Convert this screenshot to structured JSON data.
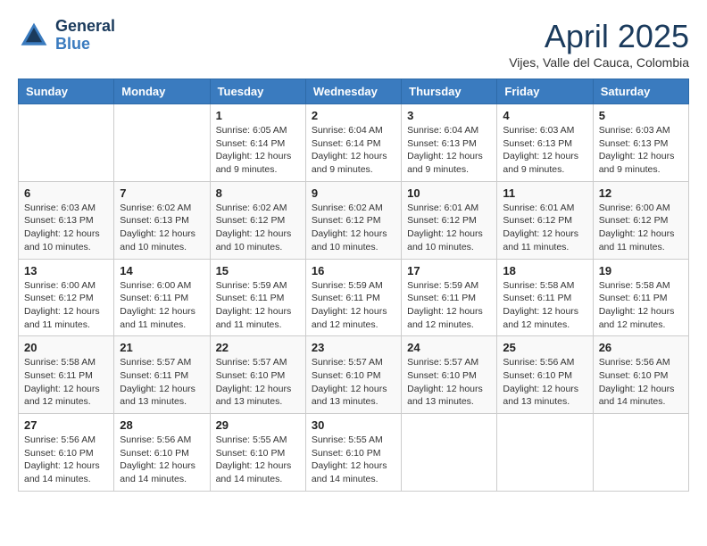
{
  "logo": {
    "general": "General",
    "blue": "Blue"
  },
  "title": "April 2025",
  "location": "Vijes, Valle del Cauca, Colombia",
  "weekdays": [
    "Sunday",
    "Monday",
    "Tuesday",
    "Wednesday",
    "Thursday",
    "Friday",
    "Saturday"
  ],
  "weeks": [
    [
      {
        "day": "",
        "info": ""
      },
      {
        "day": "",
        "info": ""
      },
      {
        "day": "1",
        "info": "Sunrise: 6:05 AM\nSunset: 6:14 PM\nDaylight: 12 hours and 9 minutes."
      },
      {
        "day": "2",
        "info": "Sunrise: 6:04 AM\nSunset: 6:14 PM\nDaylight: 12 hours and 9 minutes."
      },
      {
        "day": "3",
        "info": "Sunrise: 6:04 AM\nSunset: 6:13 PM\nDaylight: 12 hours and 9 minutes."
      },
      {
        "day": "4",
        "info": "Sunrise: 6:03 AM\nSunset: 6:13 PM\nDaylight: 12 hours and 9 minutes."
      },
      {
        "day": "5",
        "info": "Sunrise: 6:03 AM\nSunset: 6:13 PM\nDaylight: 12 hours and 9 minutes."
      }
    ],
    [
      {
        "day": "6",
        "info": "Sunrise: 6:03 AM\nSunset: 6:13 PM\nDaylight: 12 hours and 10 minutes."
      },
      {
        "day": "7",
        "info": "Sunrise: 6:02 AM\nSunset: 6:13 PM\nDaylight: 12 hours and 10 minutes."
      },
      {
        "day": "8",
        "info": "Sunrise: 6:02 AM\nSunset: 6:12 PM\nDaylight: 12 hours and 10 minutes."
      },
      {
        "day": "9",
        "info": "Sunrise: 6:02 AM\nSunset: 6:12 PM\nDaylight: 12 hours and 10 minutes."
      },
      {
        "day": "10",
        "info": "Sunrise: 6:01 AM\nSunset: 6:12 PM\nDaylight: 12 hours and 10 minutes."
      },
      {
        "day": "11",
        "info": "Sunrise: 6:01 AM\nSunset: 6:12 PM\nDaylight: 12 hours and 11 minutes."
      },
      {
        "day": "12",
        "info": "Sunrise: 6:00 AM\nSunset: 6:12 PM\nDaylight: 12 hours and 11 minutes."
      }
    ],
    [
      {
        "day": "13",
        "info": "Sunrise: 6:00 AM\nSunset: 6:12 PM\nDaylight: 12 hours and 11 minutes."
      },
      {
        "day": "14",
        "info": "Sunrise: 6:00 AM\nSunset: 6:11 PM\nDaylight: 12 hours and 11 minutes."
      },
      {
        "day": "15",
        "info": "Sunrise: 5:59 AM\nSunset: 6:11 PM\nDaylight: 12 hours and 11 minutes."
      },
      {
        "day": "16",
        "info": "Sunrise: 5:59 AM\nSunset: 6:11 PM\nDaylight: 12 hours and 12 minutes."
      },
      {
        "day": "17",
        "info": "Sunrise: 5:59 AM\nSunset: 6:11 PM\nDaylight: 12 hours and 12 minutes."
      },
      {
        "day": "18",
        "info": "Sunrise: 5:58 AM\nSunset: 6:11 PM\nDaylight: 12 hours and 12 minutes."
      },
      {
        "day": "19",
        "info": "Sunrise: 5:58 AM\nSunset: 6:11 PM\nDaylight: 12 hours and 12 minutes."
      }
    ],
    [
      {
        "day": "20",
        "info": "Sunrise: 5:58 AM\nSunset: 6:11 PM\nDaylight: 12 hours and 12 minutes."
      },
      {
        "day": "21",
        "info": "Sunrise: 5:57 AM\nSunset: 6:11 PM\nDaylight: 12 hours and 13 minutes."
      },
      {
        "day": "22",
        "info": "Sunrise: 5:57 AM\nSunset: 6:10 PM\nDaylight: 12 hours and 13 minutes."
      },
      {
        "day": "23",
        "info": "Sunrise: 5:57 AM\nSunset: 6:10 PM\nDaylight: 12 hours and 13 minutes."
      },
      {
        "day": "24",
        "info": "Sunrise: 5:57 AM\nSunset: 6:10 PM\nDaylight: 12 hours and 13 minutes."
      },
      {
        "day": "25",
        "info": "Sunrise: 5:56 AM\nSunset: 6:10 PM\nDaylight: 12 hours and 13 minutes."
      },
      {
        "day": "26",
        "info": "Sunrise: 5:56 AM\nSunset: 6:10 PM\nDaylight: 12 hours and 14 minutes."
      }
    ],
    [
      {
        "day": "27",
        "info": "Sunrise: 5:56 AM\nSunset: 6:10 PM\nDaylight: 12 hours and 14 minutes."
      },
      {
        "day": "28",
        "info": "Sunrise: 5:56 AM\nSunset: 6:10 PM\nDaylight: 12 hours and 14 minutes."
      },
      {
        "day": "29",
        "info": "Sunrise: 5:55 AM\nSunset: 6:10 PM\nDaylight: 12 hours and 14 minutes."
      },
      {
        "day": "30",
        "info": "Sunrise: 5:55 AM\nSunset: 6:10 PM\nDaylight: 12 hours and 14 minutes."
      },
      {
        "day": "",
        "info": ""
      },
      {
        "day": "",
        "info": ""
      },
      {
        "day": "",
        "info": ""
      }
    ]
  ]
}
